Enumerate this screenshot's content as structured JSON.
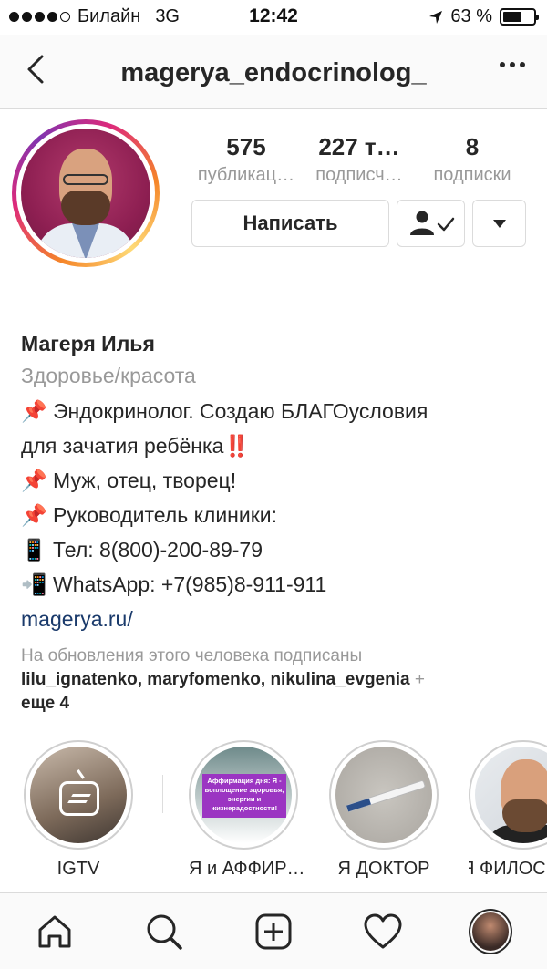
{
  "status_bar": {
    "carrier": "Билайн",
    "network": "3G",
    "time": "12:42",
    "battery_percent": "63 %",
    "battery_level": 0.63,
    "signal_bars": 4
  },
  "header": {
    "title": "magerya_endocrinolog_",
    "back_icon": "chevron-left-icon",
    "more_icon": "more-horizontal-icon"
  },
  "stats": [
    {
      "value": "575",
      "label": "публикац…"
    },
    {
      "value": "227 т…",
      "label": "подписч…"
    },
    {
      "value": "8",
      "label": "подписки"
    }
  ],
  "actions": {
    "message_label": "Написать",
    "following_icon": "person-check-icon",
    "dropdown_icon": "triangle-down-icon"
  },
  "bio": {
    "name": "Магеря Илья",
    "category": "Здоровье/красота",
    "lines": [
      "📌 Эндокринолог. Создаю БЛАГОусловия",
      "для зачатия ребёнка‼️",
      "📌 Муж, отец, творец!",
      "📌 Руководитель клиники:",
      "📱 Тел: 8(800)-200-89-79",
      "📲 WhatsApp: +7(985)8-911-911"
    ],
    "link": "magerya.ru/"
  },
  "followed_by": {
    "label": "На обновления этого человека подписаны",
    "names": "lilu_ignatenko, maryfomenko, nikulina_evgenia",
    "plus": "+",
    "more": "еще 4"
  },
  "highlights": [
    {
      "label": "IGTV"
    },
    {
      "label": "Я и АФФИР…",
      "overlay_text": "Аффирмация дня: Я - воплощение здоровья, энергии и жизнерадостности!"
    },
    {
      "label": "Я ДОКТОР"
    },
    {
      "label": "Я ФИЛОС"
    }
  ],
  "tabbar": {
    "items": [
      "home-icon",
      "search-icon",
      "add-post-icon",
      "heart-icon",
      "profile-avatar"
    ]
  }
}
